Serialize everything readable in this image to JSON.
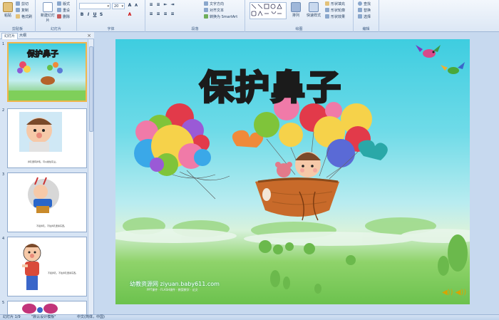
{
  "ribbon": {
    "groups": {
      "clipboard": "剪贴板",
      "slides": "幻灯片",
      "font": "字体",
      "paragraph": "段落",
      "drawing": "绘图",
      "editing": "编辑"
    },
    "clipboard": {
      "paste": "粘贴",
      "cut": "剪切",
      "copy": "复制",
      "format_painter": "格式刷"
    },
    "slides": {
      "new_slide": "新建幻灯片",
      "layout": "版式",
      "reset": "重设",
      "delete": "删除"
    },
    "font": {
      "font_name": "",
      "font_size": "20"
    },
    "paragraph": {
      "text_direction": "文字方向",
      "align_text": "对齐文本",
      "smartart": "转换为 SmartArt"
    },
    "drawing": {
      "arrange": "排列",
      "quick_styles": "快速样式",
      "shape_fill": "形状填充",
      "shape_outline": "形状轮廓",
      "shape_effects": "形状效果"
    },
    "editing": {
      "find": "查找",
      "replace": "替换",
      "select": "选择"
    }
  },
  "panel": {
    "tabs": [
      "幻灯片",
      "大纲"
    ],
    "close": "×",
    "thumbnails": [
      {
        "num": "1",
        "title": "保护鼻子",
        "caption": ""
      },
      {
        "num": "2",
        "title": "",
        "caption": "鼻孔里有鼻毛，可以挡住灰尘。"
      },
      {
        "num": "3",
        "title": "",
        "caption": "不挖鼻孔，不往鼻孔里塞东西。"
      },
      {
        "num": "4",
        "title": "",
        "caption": "不挖鼻孔，不往鼻孔里塞东西。"
      },
      {
        "num": "5",
        "title": "",
        "caption": ""
      }
    ]
  },
  "slide": {
    "title": "保护鼻子",
    "footer": "幼教资源网 ziyuan.baby611.com",
    "footer_small": "PPT课件 · FLASH课件 · 教案教学 · 论文"
  },
  "status": {
    "slide_info": "幻灯片 1/9",
    "theme": "\"默认设计模板\"",
    "language": "中文(简体，中国)"
  }
}
